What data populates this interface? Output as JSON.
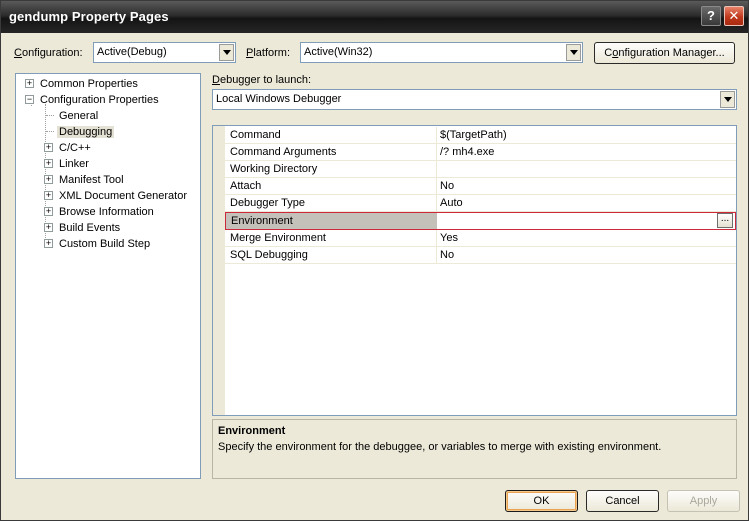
{
  "window": {
    "title": "gendump Property Pages"
  },
  "title_buttons": {
    "help": "?",
    "close": "✕"
  },
  "config": {
    "configuration_label_u": "C",
    "configuration_label_rest": "onfiguration:",
    "configuration_value": "Active(Debug)",
    "platform_label_u": "P",
    "platform_label_rest": "latform:",
    "platform_value": "Active(Win32)",
    "manager_button_u": "o",
    "manager_button_pre": "C",
    "manager_button_post": "nfiguration Manager..."
  },
  "tree": {
    "items": [
      {
        "label": "Common Properties",
        "expander": "+"
      },
      {
        "label": "Configuration Properties",
        "expander": "−"
      },
      {
        "label": "General"
      },
      {
        "label": "Debugging"
      },
      {
        "label": "C/C++",
        "expander": "+"
      },
      {
        "label": "Linker",
        "expander": "+"
      },
      {
        "label": "Manifest Tool",
        "expander": "+"
      },
      {
        "label": "XML Document Generator",
        "expander": "+"
      },
      {
        "label": "Browse Information",
        "expander": "+"
      },
      {
        "label": "Build Events",
        "expander": "+"
      },
      {
        "label": "Custom Build Step",
        "expander": "+"
      }
    ]
  },
  "debugger": {
    "label_u": "D",
    "label_rest": "ebugger to launch:",
    "value": "Local Windows Debugger"
  },
  "grid": {
    "rows": [
      {
        "name": "Command",
        "value": "$(TargetPath)"
      },
      {
        "name": "Command Arguments",
        "value": "/? mh4.exe"
      },
      {
        "name": "Working Directory",
        "value": ""
      },
      {
        "name": "Attach",
        "value": "No"
      },
      {
        "name": "Debugger Type",
        "value": "Auto"
      },
      {
        "name": "Environment",
        "value": "",
        "ellipsis": "..."
      },
      {
        "name": "Merge Environment",
        "value": "Yes"
      },
      {
        "name": "SQL Debugging",
        "value": "No"
      }
    ]
  },
  "description": {
    "title": "Environment",
    "text": "Specify the environment for the debuggee, or variables to merge with existing environment."
  },
  "buttons": {
    "ok": "OK",
    "cancel": "Cancel",
    "apply": "Apply"
  },
  "colors": {
    "highlight_border": "#cc2a3a",
    "dialog_bg": "#ece9d8",
    "titlebar": "#1e1e1e"
  }
}
